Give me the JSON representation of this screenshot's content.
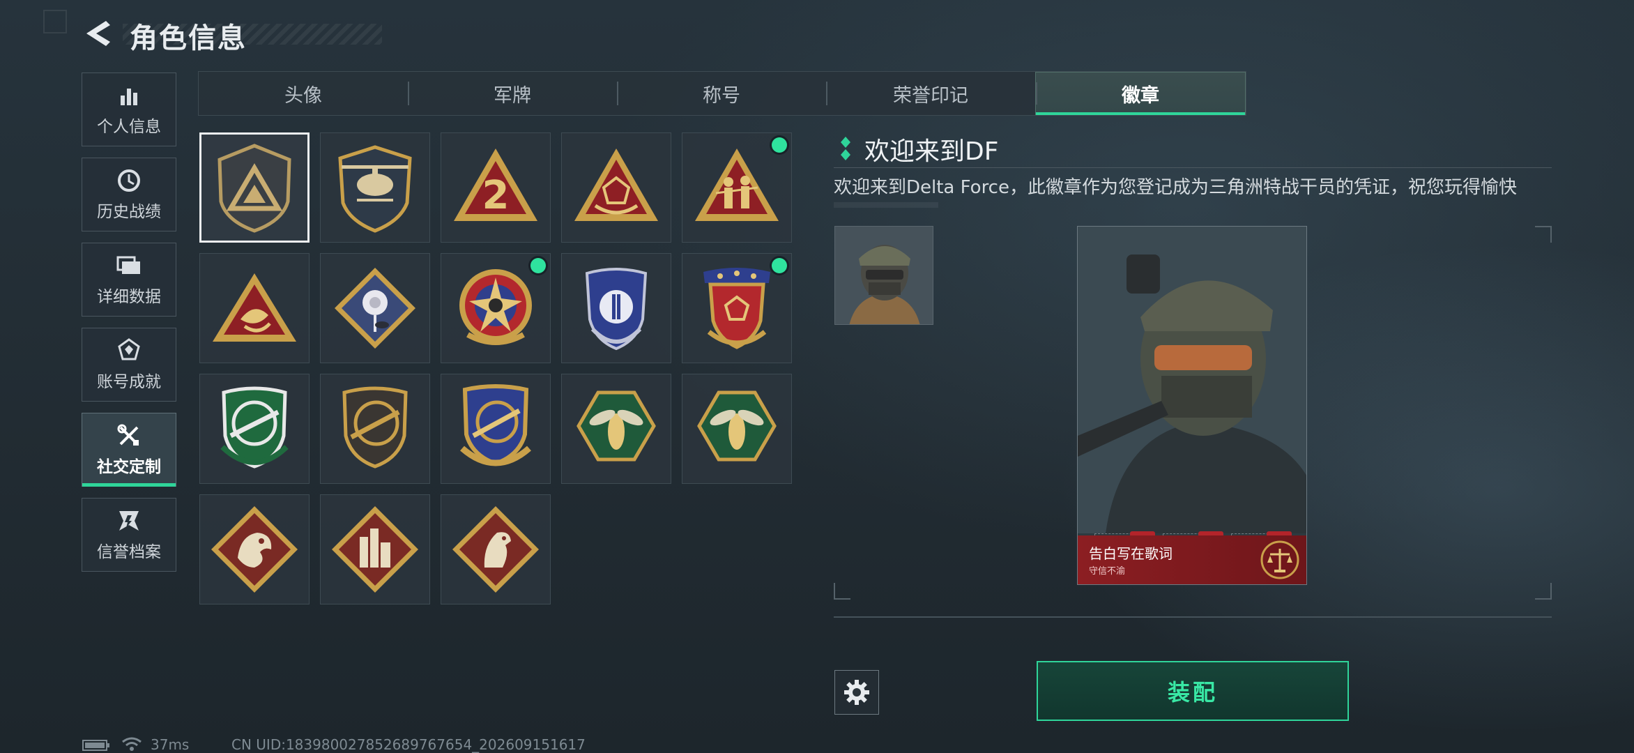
{
  "header": {
    "title": "角色信息"
  },
  "sidebar": {
    "items": [
      {
        "label": "个人信息",
        "icon": "bar-chart-icon"
      },
      {
        "label": "历史战绩",
        "icon": "history-icon"
      },
      {
        "label": "详细数据",
        "icon": "folder-icon"
      },
      {
        "label": "账号成就",
        "icon": "achievement-icon"
      },
      {
        "label": "社交定制",
        "icon": "tools-icon",
        "active": true
      },
      {
        "label": "信誉档案",
        "icon": "credit-icon"
      }
    ]
  },
  "tabs": [
    {
      "label": "头像"
    },
    {
      "label": "军牌"
    },
    {
      "label": "称号"
    },
    {
      "label": "荣誉印记"
    },
    {
      "label": "徽章",
      "active": true
    }
  ],
  "badges": [
    {
      "name": "delta-triangle-badge",
      "selected": true,
      "new": false
    },
    {
      "name": "helicopter-badge",
      "new": false
    },
    {
      "name": "red-number-two-badge",
      "new": false
    },
    {
      "name": "hand-dice-badge",
      "new": false
    },
    {
      "name": "soldiers-badge",
      "new": true
    },
    {
      "name": "fish-badge",
      "new": false
    },
    {
      "name": "rose-badge",
      "new": false
    },
    {
      "name": "star-skull-badge",
      "new": true
    },
    {
      "name": "blue-shield-badge",
      "new": false
    },
    {
      "name": "red-shield-stars-badge",
      "new": true
    },
    {
      "name": "green-rifle-badge",
      "new": false
    },
    {
      "name": "dark-rifle-badge",
      "new": false
    },
    {
      "name": "gold-rifle-badge",
      "new": false
    },
    {
      "name": "green-wasp-badge",
      "new": false
    },
    {
      "name": "green-wasp-badge-2",
      "new": false
    },
    {
      "name": "dragon-badge",
      "new": false
    },
    {
      "name": "city-badge",
      "new": false
    },
    {
      "name": "horse-badge",
      "new": false
    }
  ],
  "detail": {
    "title": "欢迎来到DF",
    "description": "欢迎来到Delta Force，此徽章作为您登记成为三角洲特战干员的凭证，祝您玩得愉快"
  },
  "card": {
    "name": "告白写在歌词",
    "subtitle": "守信不渝"
  },
  "buttons": {
    "equip": "装配"
  },
  "status": {
    "ping": "37ms",
    "uid": "CN UID:1839800278526897676​54_202609151617"
  },
  "colors": {
    "accent": "#2fd59a",
    "card_red": "#8c1e22",
    "gold": "#c9a04a"
  }
}
